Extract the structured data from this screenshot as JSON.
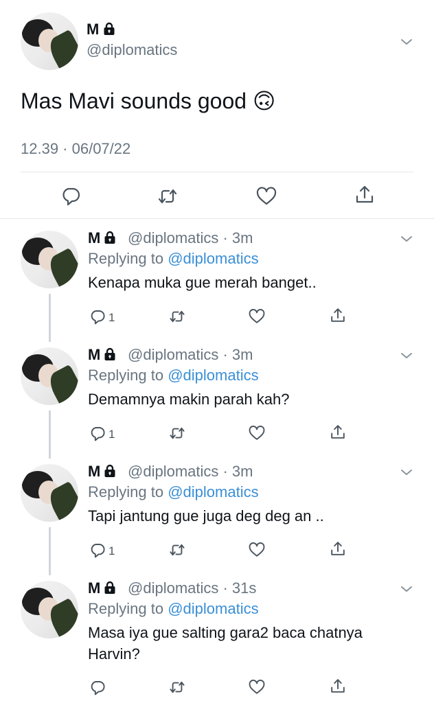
{
  "main_tweet": {
    "name": "M",
    "handle": "@diplomatics",
    "text": "Mas Mavi sounds good 🙃",
    "timestamp": "12.39 · 06/07/22"
  },
  "replying_label": "Replying to",
  "replying_mention": "@diplomatics",
  "replies": [
    {
      "name": "M",
      "handle_time": "@diplomatics · 3m",
      "text": "Kenapa muka gue merah banget..",
      "reply_count": "1"
    },
    {
      "name": "M",
      "handle_time": "@diplomatics · 3m",
      "text": "Demamnya makin parah kah?",
      "reply_count": "1"
    },
    {
      "name": "M",
      "handle_time": "@diplomatics · 3m",
      "text": "Tapi jantung gue juga deg deg an ..",
      "reply_count": "1"
    },
    {
      "name": "M",
      "handle_time": "@diplomatics · 31s",
      "text": "Masa iya gue salting gara2 baca chatnya Harvin?",
      "reply_count": ""
    }
  ],
  "colors": {
    "accent_link": "#3a8fd6",
    "muted_text": "#697580",
    "icon_gray": "#4a545d",
    "divider": "#e3e6e8"
  },
  "icons": [
    "lock-icon",
    "chevron-down-icon",
    "reply-icon",
    "retweet-icon",
    "like-icon",
    "share-icon"
  ]
}
